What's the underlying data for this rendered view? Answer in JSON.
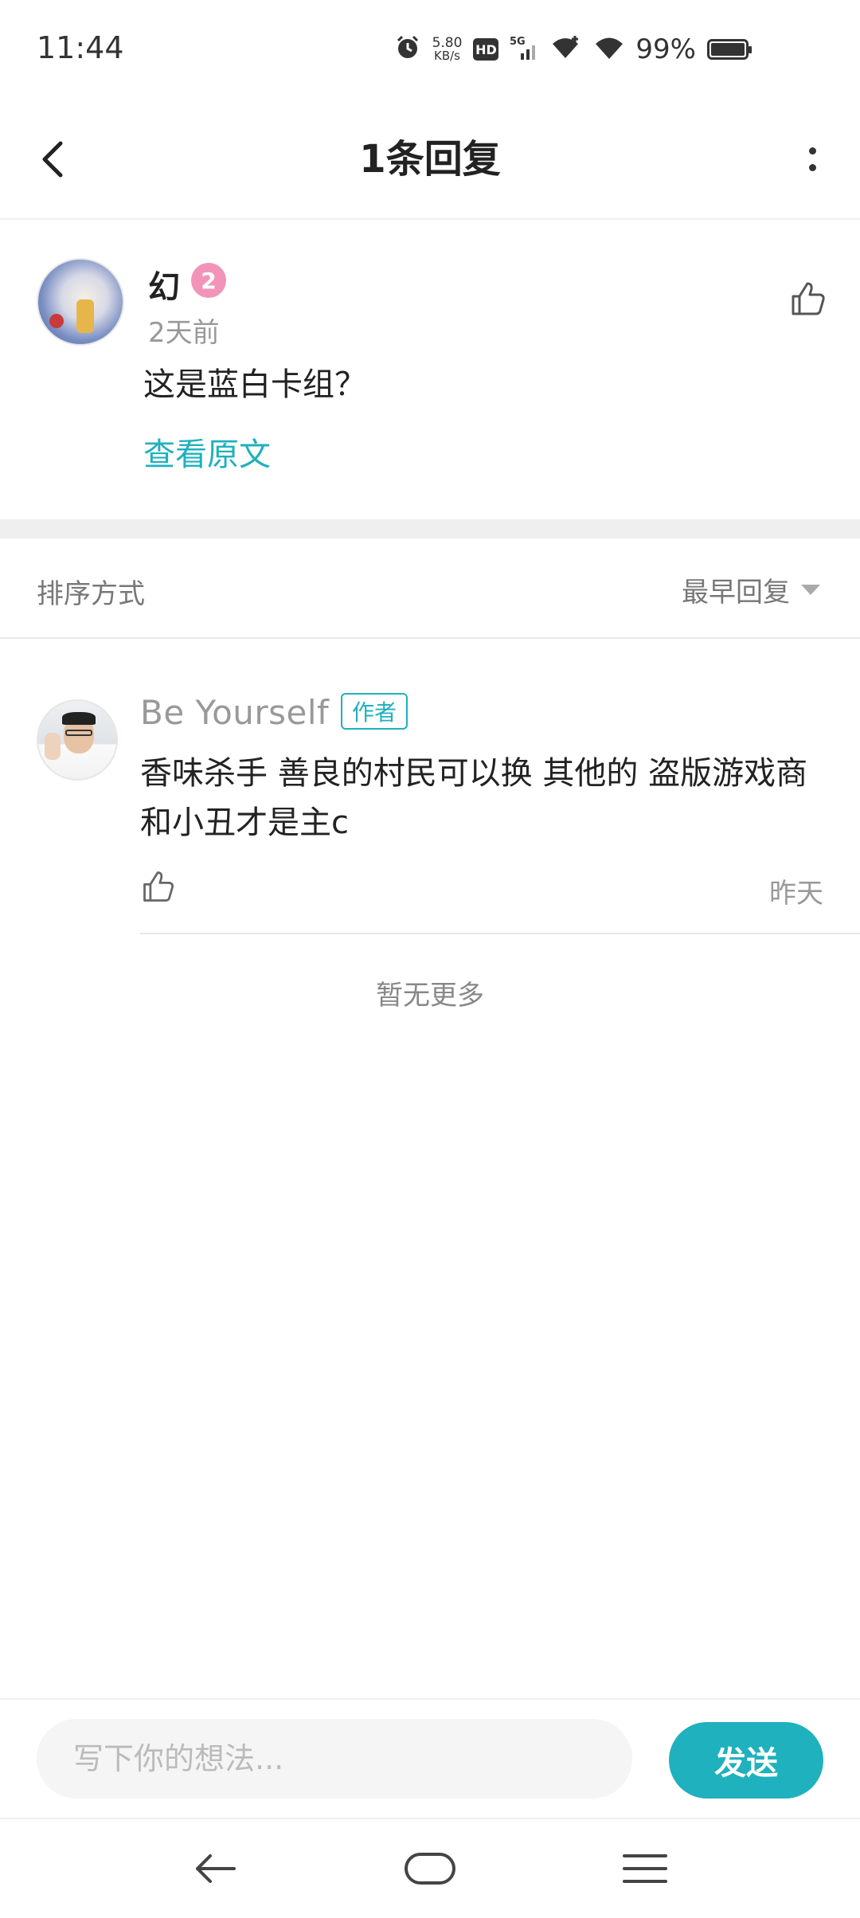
{
  "status_bar": {
    "time": "11:44",
    "net_speed_value": "5.80",
    "net_speed_unit": "KB/s",
    "hd_label": "HD",
    "network": "5G",
    "battery_percent": "99%",
    "battery_level": 0.99
  },
  "header": {
    "title": "1条回复"
  },
  "main_comment": {
    "username": "幻",
    "level": "2",
    "time": "2天前",
    "text": "这是蓝白卡组？",
    "view_original": "查看原文"
  },
  "sort": {
    "label": "排序方式",
    "value": "最早回复"
  },
  "reply": {
    "username": "Be  Yourself",
    "author_badge": "作者",
    "text": "香味杀手 善良的村民可以换 其他的   盗版游戏商 和小丑才是主c",
    "time": "昨天"
  },
  "footer_note": "暂无更多",
  "input": {
    "placeholder": "写下你的想法...",
    "value": "",
    "send_label": "发送"
  },
  "colors": {
    "accent": "#1fb1bd",
    "level_badge": "#f294b8"
  }
}
